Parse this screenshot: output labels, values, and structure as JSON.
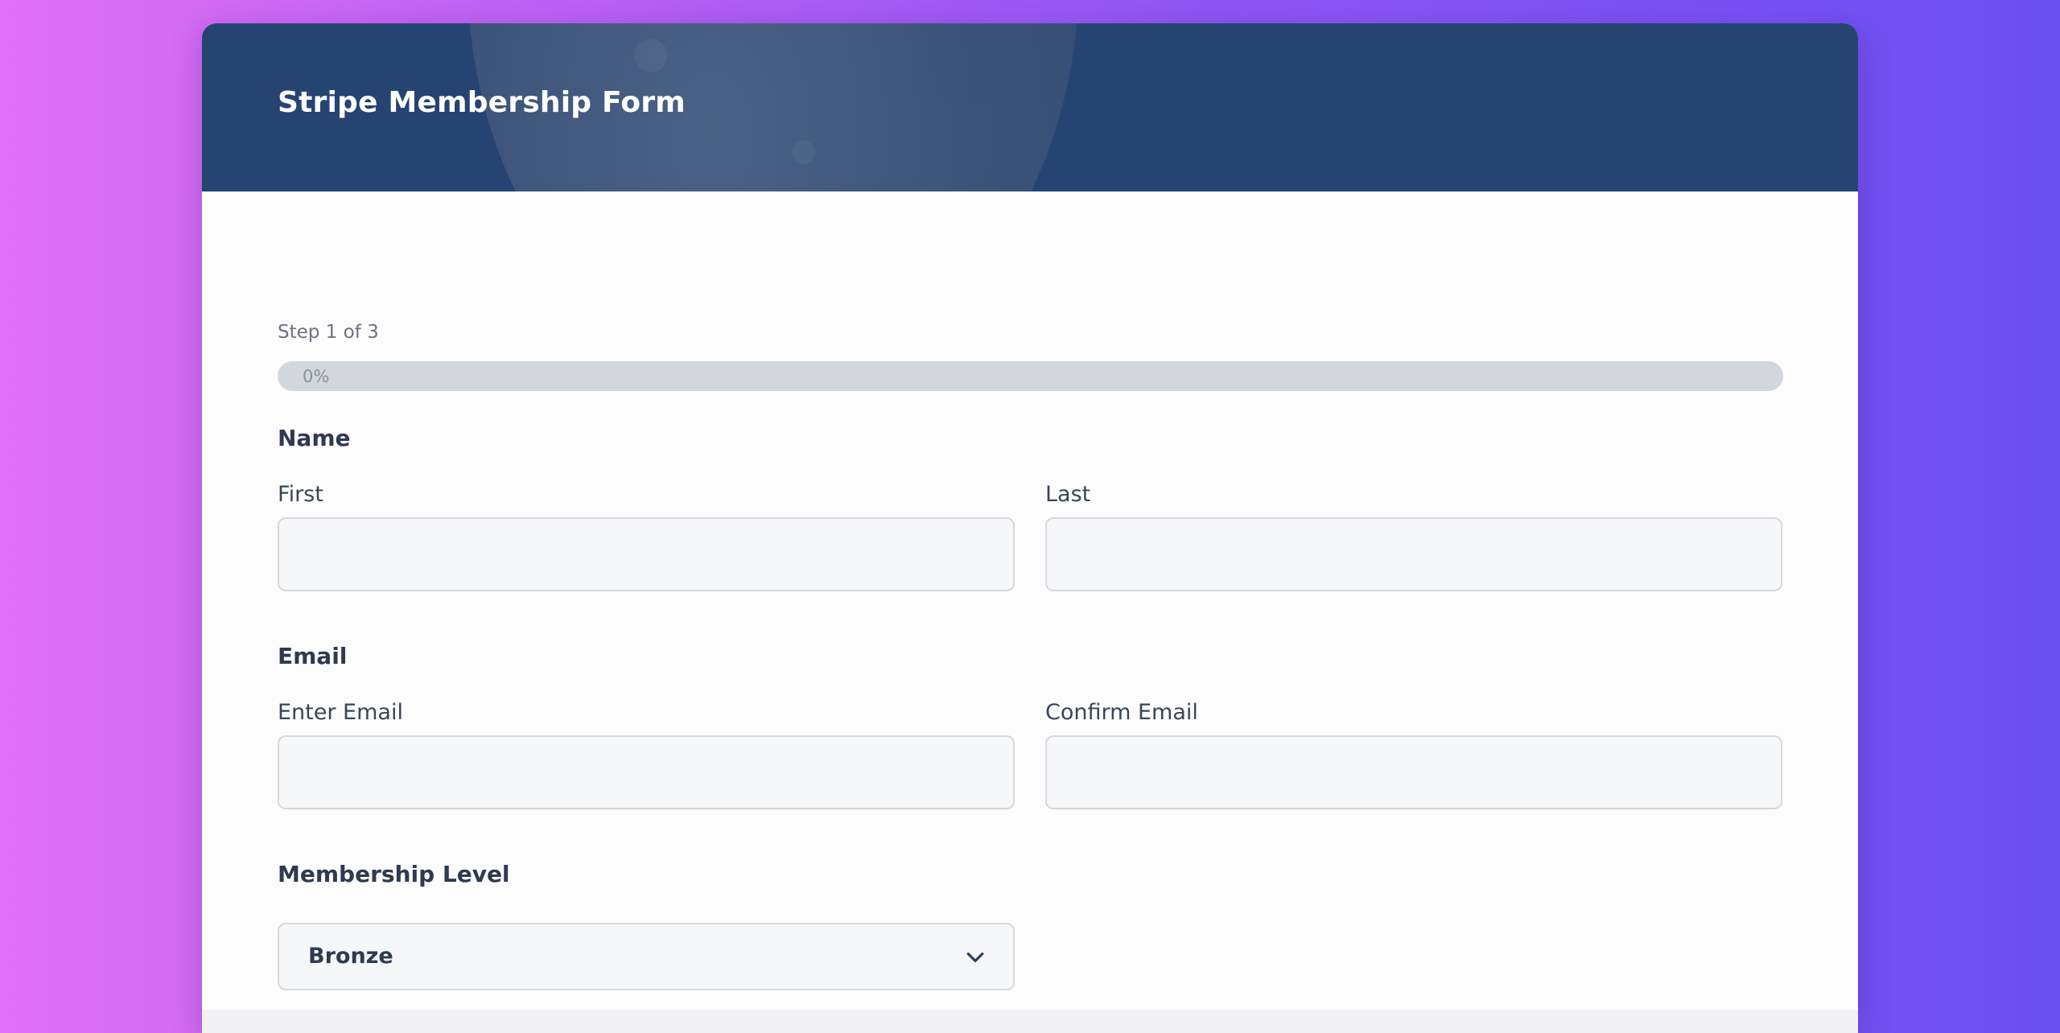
{
  "form": {
    "title": "Stripe Membership Form"
  },
  "progress": {
    "step_text": "Step 1 of 3",
    "percent_text": "0%",
    "value": 0
  },
  "name_section": {
    "label": "Name",
    "first_label": "First",
    "first_value": "",
    "last_label": "Last",
    "last_value": ""
  },
  "email_section": {
    "label": "Email",
    "enter_label": "Enter Email",
    "enter_value": "",
    "confirm_label": "Confirm Email",
    "confirm_value": ""
  },
  "membership_section": {
    "label": "Membership Level",
    "selected": "Bronze"
  },
  "colors": {
    "header_bg": "#254472",
    "text_dark": "#2e3a50",
    "track": "#d3d6da"
  }
}
